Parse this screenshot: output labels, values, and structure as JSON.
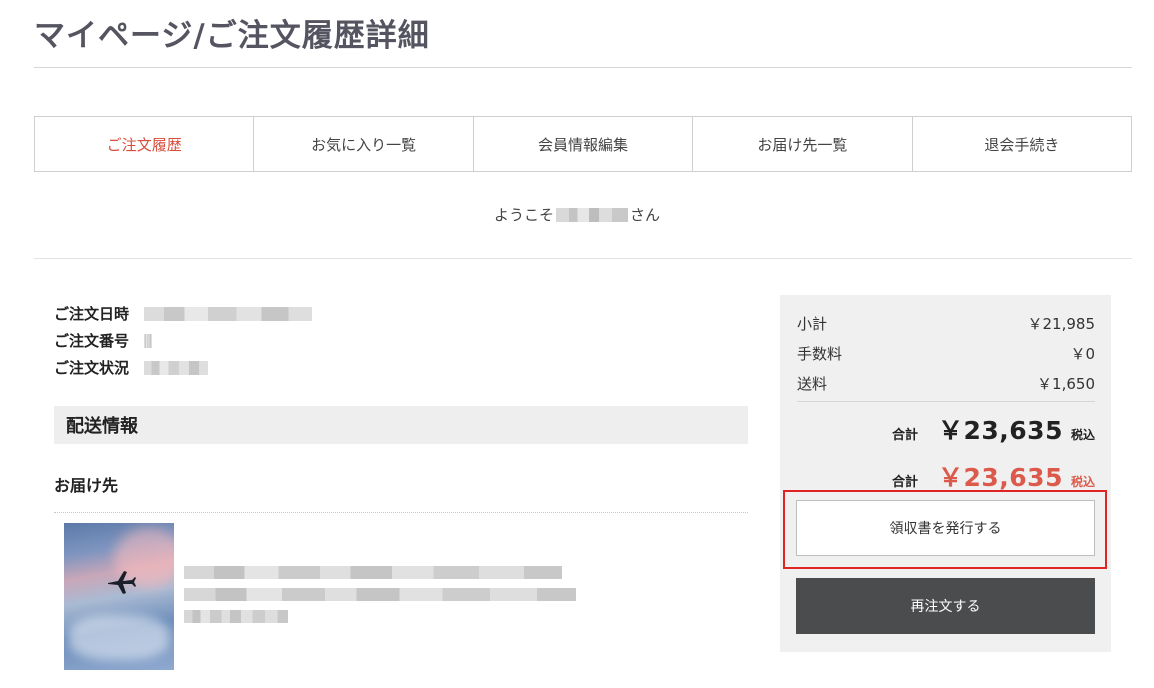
{
  "page": {
    "title": "マイページ/ご注文履歴詳細"
  },
  "tabs": [
    {
      "label": "ご注文履歴",
      "active": true
    },
    {
      "label": "お気に入り一覧",
      "active": false
    },
    {
      "label": "会員情報編集",
      "active": false
    },
    {
      "label": "お届け先一覧",
      "active": false
    },
    {
      "label": "退会手続き",
      "active": false
    }
  ],
  "welcome": {
    "prefix": "ようこそ",
    "suffix": "さん"
  },
  "order": {
    "date_label": "ご注文日時",
    "number_label": "ご注文番号",
    "status_label": "ご注文状況"
  },
  "shipping": {
    "header": "配送情報",
    "destination_label": "お届け先"
  },
  "summary": {
    "subtotal_label": "小計",
    "subtotal_value": "￥21,985",
    "fee_label": "手数料",
    "fee_value": "￥0",
    "shipping_label": "送料",
    "shipping_value": "￥1,650",
    "total_label": "合計",
    "total_value": "￥23,635",
    "tax_label": "税込",
    "total2_label": "合計",
    "total2_value": "￥23,635",
    "tax2_label": "税込"
  },
  "buttons": {
    "receipt": "領収書を発行する",
    "reorder": "再注文する"
  },
  "icons": {
    "product_image": "airplane-icon"
  },
  "colors": {
    "accent": "#d94c3a",
    "price_red": "#dc5a4b",
    "highlight_frame": "#e02424",
    "reorder_bg": "#4a4c4e"
  }
}
